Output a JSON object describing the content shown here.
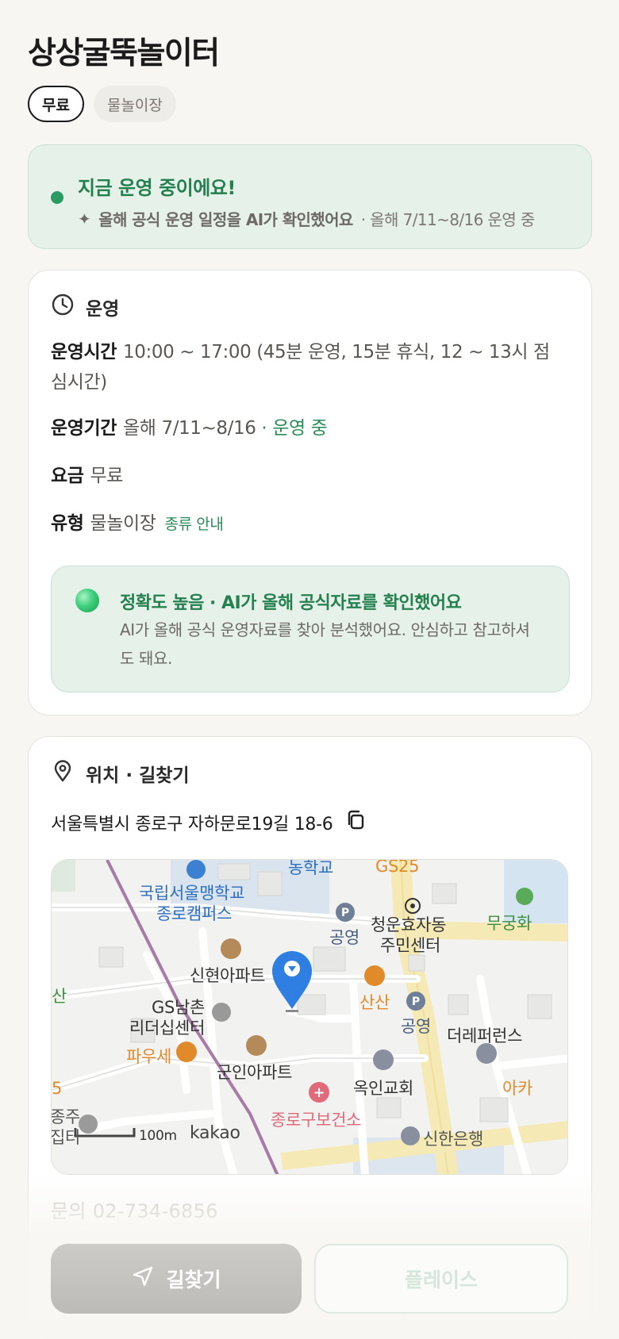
{
  "place": {
    "title": "상상굴뚝놀이터",
    "tags": [
      "무료",
      "물놀이장"
    ]
  },
  "status": {
    "headline": "지금 운영 중이에요!",
    "ai_note": "올해 공식 운영 일정을 AI가 확인했어요",
    "period_note": "· 올해 7/11~8/16 운영 중",
    "dot_color": "#2b9b63"
  },
  "operation": {
    "section_title": "운영",
    "hours_label": "운영시간",
    "hours_value": "10:00 ~ 17:00 (45분 운영, 15분 휴식, 12 ~ 13시 점심시간)",
    "period_label": "운영기간",
    "period_value": "올해 7/11~8/16",
    "period_status": "· 운영 중",
    "fee_label": "요금",
    "fee_value": "무료",
    "type_label": "유형",
    "type_value": "물놀이장",
    "type_link": "종류 안내",
    "accuracy_title": "정확도 높음 · AI가 올해 공식자료를 확인했어요",
    "accuracy_body": "AI가 올해 공식 운영자료를 찾아 분석했어요. 안심하고 참고하셔도 돼요."
  },
  "location": {
    "section_title": "위치 · 길찾기",
    "address": "서울특별시 종로구 자하문로19길 18-6",
    "map_labels": {
      "school": "국립서울맹학교",
      "school2": "종로캠퍼스",
      "top_school": "농학교",
      "gs25": "GS25",
      "parking1": "공영",
      "center1": "청운효자동",
      "center2": "주민센터",
      "mugung": "무궁화",
      "apt1": "신현아파트",
      "sansan": "산산",
      "parking2": "공영",
      "gs1": "GS남촌",
      "gs2": "리더십센터",
      "apt2": "군인아파트",
      "dept": "더레퍼런스",
      "pause": "파우세",
      "church": "옥인교회",
      "clinic": "종로구보건소",
      "bank": "신한은행",
      "aka": "아카",
      "san_left": "산",
      "left1": "종주",
      "left2": "집터",
      "left_num": "5",
      "scale": "100m",
      "brand": "kakao"
    },
    "inquiry": "문의 02-734-6856"
  },
  "actions": {
    "navigate": "길찾기",
    "place": "플레이스"
  }
}
